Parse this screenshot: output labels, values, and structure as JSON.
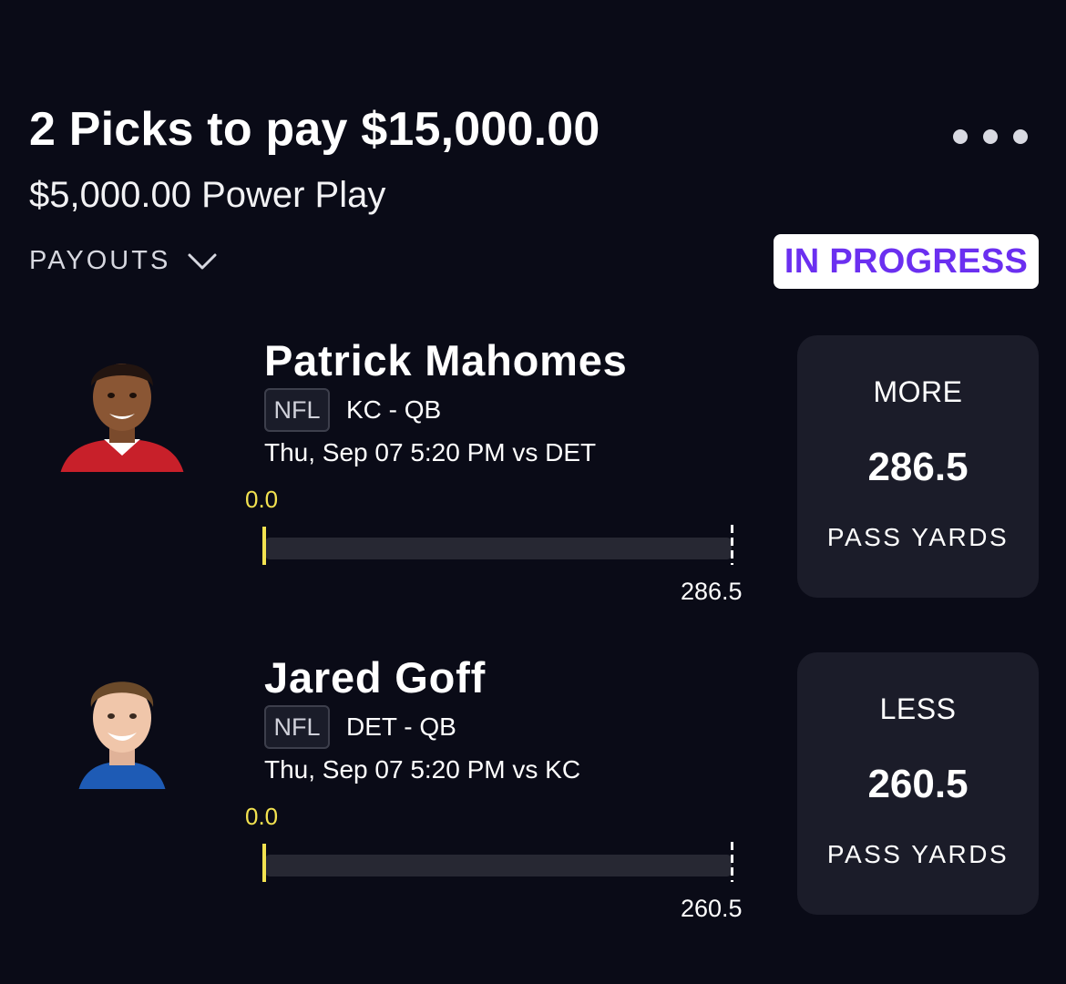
{
  "header": {
    "title": "2 Picks to pay $15,000.00",
    "subtitle": "$5,000.00 Power Play",
    "payouts_label": "PAYOUTS",
    "status": "IN PROGRESS"
  },
  "picks": [
    {
      "player": "Patrick Mahomes",
      "league": "NFL",
      "team_position": "KC - QB",
      "game_time": "Thu, Sep 07 5:20 PM  vs DET",
      "current": "0.0",
      "target": "286.5",
      "progress_fraction": 0,
      "direction": "MORE",
      "line": "286.5",
      "stat": "PASS YARDS",
      "jersey_color": "#c8202a"
    },
    {
      "player": "Jared Goff",
      "league": "NFL",
      "team_position": "DET - QB",
      "game_time": "Thu, Sep 07 5:20 PM  vs KC",
      "current": "0.0",
      "target": "260.5",
      "progress_fraction": 0,
      "direction": "LESS",
      "line": "260.5",
      "stat": "PASS YARDS",
      "jersey_color": "#1e5bb5"
    }
  ],
  "colors": {
    "background": "#0a0b17",
    "accent_purple": "#6b2ff0",
    "progress_yellow": "#f2e250",
    "card": "#1b1c29"
  },
  "icons": {
    "more": "more-horizontal-icon",
    "payouts": "chevron-down-icon"
  }
}
